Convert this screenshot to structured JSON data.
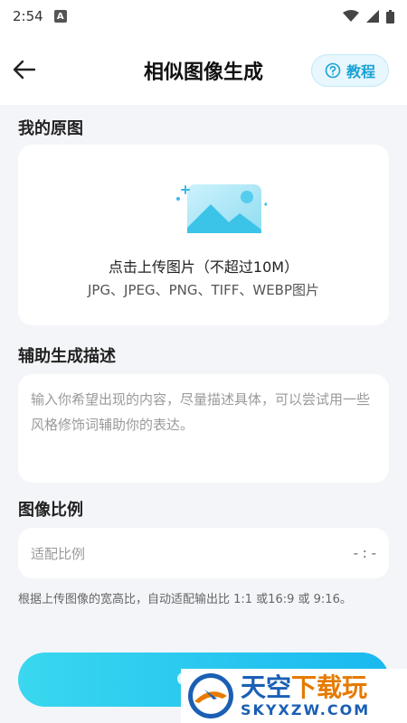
{
  "status_bar": {
    "time": "2:54",
    "notif_letter": "A"
  },
  "header": {
    "title": "相似图像生成",
    "tutorial_label": "教程"
  },
  "sections": {
    "original_label": "我的原图",
    "upload_main": "点击上传图片（不超过10M）",
    "upload_formats": "JPG、JPEG、PNG、TIFF、WEBP图片",
    "desc_label": "辅助生成描述",
    "desc_placeholder": "输入你希望出现的内容，尽量描述具体，可以尝试用一些风格修饰词辅助你的表达。",
    "ratio_label": "图像比例",
    "ratio_field_label": "适配比例",
    "ratio_value": "- : -",
    "ratio_hint": "根据上传图像的宽高比，自动适配输出比 1:1 或16:9 或 9:16。"
  },
  "watermark": {
    "title_part1": "天空",
    "title_part2": "下载玩",
    "subtitle": "SKYXZW.COM"
  },
  "colors": {
    "accent": "#19a3d6",
    "button_start": "#3ad7ef",
    "button_end": "#19b9f0"
  }
}
